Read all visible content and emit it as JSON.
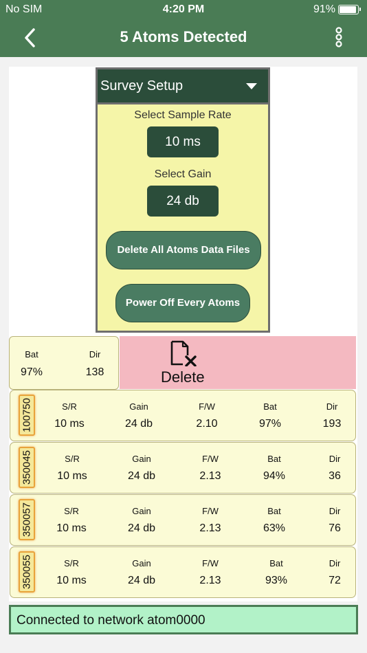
{
  "status_bar": {
    "carrier": "No SIM",
    "time": "4:20 PM",
    "battery": "91%",
    "battery_level": 0.91
  },
  "nav": {
    "title": "5 Atoms Detected",
    "back_icon": "chevron-left-icon",
    "menu_icon": "more-vertical-icon"
  },
  "setup": {
    "dropdown_label": "Survey Setup",
    "sample_rate_label": "Select Sample Rate",
    "sample_rate_value": "10 ms",
    "gain_label": "Select Gain",
    "gain_value": "24 db",
    "delete_all_label": "Delete All Atoms Data Files",
    "power_off_label": "Power Off Every Atoms"
  },
  "selected_row": {
    "bat_label": "Bat",
    "dir_label": "Dir",
    "bat": "97%",
    "dir": "138"
  },
  "delete_action": {
    "label": "Delete",
    "icon": "delete-file-icon"
  },
  "columns": {
    "sr": "S/R",
    "gain": "Gain",
    "fw": "F/W",
    "bat": "Bat",
    "dir": "Dir"
  },
  "atoms": [
    {
      "id": "100750",
      "sr": "10 ms",
      "gain": "24 db",
      "fw": "2.10",
      "bat": "97%",
      "dir": "193"
    },
    {
      "id": "350045",
      "sr": "10 ms",
      "gain": "24 db",
      "fw": "2.13",
      "bat": "94%",
      "dir": "36"
    },
    {
      "id": "350057",
      "sr": "10 ms",
      "gain": "24 db",
      "fw": "2.13",
      "bat": "63%",
      "dir": "76"
    },
    {
      "id": "350055",
      "sr": "10 ms",
      "gain": "24 db",
      "fw": "2.13",
      "bat": "93%",
      "dir": "72"
    }
  ],
  "network_status": "Connected to network atom0000",
  "colors": {
    "header": "#4a7c55",
    "dark_green": "#2b4d3a",
    "panel_yellow": "#f5f5a8",
    "row_bg": "#fbfbd6",
    "delete_bg": "#f4b9c1",
    "status_bg": "#b2f2c8"
  }
}
